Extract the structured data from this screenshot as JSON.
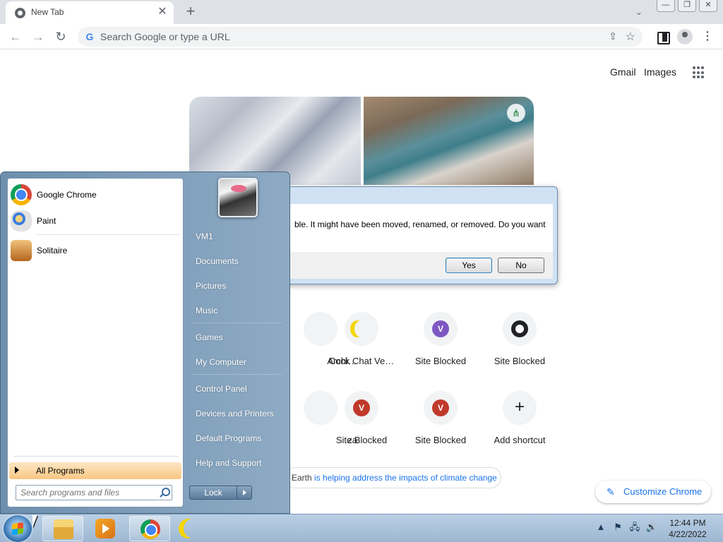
{
  "browser": {
    "tab": {
      "title": "New Tab",
      "close_glyph": "✕"
    },
    "newtab_glyph": "+",
    "tab_search_glyph": "⌄",
    "window_controls": [
      "—",
      "❐",
      "✕"
    ],
    "nav": {
      "back": "←",
      "forward": "→",
      "reload": "↻"
    },
    "omnibox": {
      "placeholder": "Search Google or type a URL",
      "g_glyph": "G",
      "share_glyph": "⇪",
      "star_glyph": "☆"
    },
    "menu_glyph": "⋮"
  },
  "ntp": {
    "links": {
      "gmail": "Gmail",
      "images": "Images"
    },
    "shortcuts_row1": [
      {
        "label": "Archi…",
        "icon": "archive-icon"
      },
      {
        "label": "Cock Chat Ve…",
        "icon": "moon-icon",
        "color": "#f5d600"
      },
      {
        "label": "Site Blocked",
        "badge": "V",
        "color": "#7e57c2"
      },
      {
        "label": "Site Blocked",
        "icon": "github-icon"
      }
    ],
    "shortcuts_row2": [
      {
        "label": "za",
        "icon": "site-icon"
      },
      {
        "label": "Site Blocked",
        "badge": "V",
        "color": "#c0392b"
      },
      {
        "label": "Site Blocked",
        "badge": "V",
        "color": "#c0392b"
      },
      {
        "label": "Add shortcut",
        "glyph": "+"
      }
    ],
    "earth_prefix": "Earth ",
    "earth_link": "is helping address the impacts of climate change",
    "customize": {
      "label": "Customize Chrome",
      "pencil_glyph": "✎"
    }
  },
  "dialog": {
    "message": "ble.  It might have been moved, renamed, or removed.  Do you want",
    "yes": "Yes",
    "no": "No"
  },
  "start_menu": {
    "pinned": [
      {
        "label": "Google Chrome",
        "icon": "chrome-icon"
      },
      {
        "label": "Paint",
        "icon": "paint-icon"
      },
      {
        "label": "Solitaire",
        "icon": "solitaire-icon"
      }
    ],
    "all_programs": "All Programs",
    "search_placeholder": "Search programs and files",
    "user": "VM1",
    "right_items": [
      "Documents",
      "Pictures",
      "Music",
      "Games",
      "My Computer",
      "Control Panel",
      "Devices and Printers",
      "Default Programs",
      "Help and Support"
    ],
    "lock": "Lock"
  },
  "taskbar": {
    "tray_glyphs": [
      "▲",
      "⚑",
      "🖧",
      "🔊"
    ],
    "time": "12:44 PM",
    "date": "4/22/2022"
  }
}
